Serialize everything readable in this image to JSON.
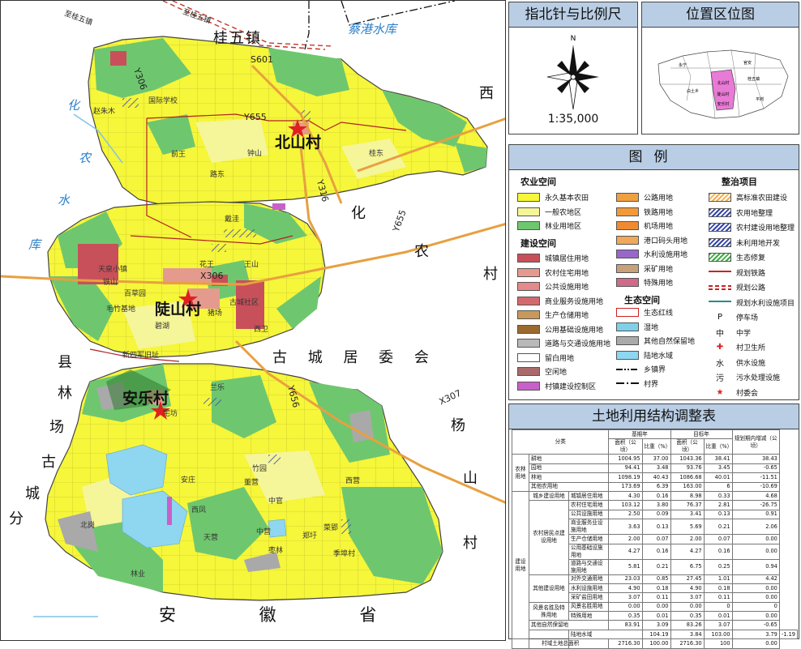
{
  "map": {
    "regions": {
      "guiwu": "桂五镇",
      "xi": "西",
      "hua": "化",
      "nong": "农",
      "cun": "村",
      "anhui": "安 徽 省",
      "gucheng_jwh": "古 城 居 委 会",
      "yang": "杨",
      "shan": "山",
      "cun2": "村",
      "west_col": [
        "县",
        "林",
        "场",
        "古",
        "城",
        "分"
      ]
    },
    "water": {
      "caigang": "蔡港水库",
      "west_col": [
        "化",
        "农",
        "水",
        "库"
      ]
    },
    "villages": {
      "beishan": "北山村",
      "lushan": "陡山村",
      "anle": "安乐村"
    },
    "roads": {
      "s601": "S601",
      "y316": "Y316",
      "y655": "Y655",
      "y655b": "Y655",
      "x306": "X306",
      "y656": "Y656",
      "x307": "X307",
      "y306": "Y306",
      "guiwu_road": "至桂五镇",
      "guiwu_road2": "至桂五镇"
    },
    "places": [
      "国际学校",
      "赵朱木",
      "钟山",
      "桂东",
      "前王",
      "路东",
      "戴洼",
      "花王",
      "王山",
      "天泉小镇",
      "毛竹基地",
      "碧湖",
      "铁山",
      "猪场",
      "古城社区",
      "西卫",
      "新四军旧址",
      "兰乐",
      "宅坊",
      "竹园",
      "中官",
      "董营",
      "安庄",
      "西营",
      "菜郢",
      "郑圩",
      "天营",
      "枣林",
      "北岗",
      "林业",
      "西凤",
      "季埠村",
      "中营",
      "百草园"
    ]
  },
  "compass": {
    "title": "指北针与比例尺",
    "north": "N",
    "scale": "1:35,000"
  },
  "location_panel": {
    "title": "位置区位图",
    "mini_labels": [
      "永宁",
      "官安",
      "北山村",
      "白土乡",
      "桂五镇",
      "陡山村",
      "安乐村",
      "平岗"
    ]
  },
  "legend": {
    "title": "图例",
    "groups": {
      "agri": "农业空间",
      "build": "建设空间",
      "eco": "生态空间",
      "renov": "整治项目"
    },
    "agri": [
      {
        "label": "永久基本农田",
        "color": "#f6f63a"
      },
      {
        "label": "一般农地区",
        "color": "#f5f59a"
      },
      {
        "label": "林业用地区",
        "color": "#6ec76e"
      }
    ],
    "build": [
      {
        "label": "城镇居住用地",
        "color": "#c8505a"
      },
      {
        "label": "农村住宅用地",
        "color": "#e59a8e"
      },
      {
        "label": "公共设施用地",
        "color": "#e48a8a"
      },
      {
        "label": "商业服务设施用地",
        "color": "#d4686f"
      },
      {
        "label": "生产仓储用地",
        "color": "#c7995a"
      },
      {
        "label": "公用基础设施用地",
        "color": "#9b6a2d"
      },
      {
        "label": "道路与交通设施用地",
        "color": "#b9b9b9"
      },
      {
        "label": "留白用地",
        "color": "#ffffff"
      },
      {
        "label": "空闲地",
        "color": "#a86a6a"
      },
      {
        "label": "村镇建设控制区",
        "color": "#c960c9"
      }
    ],
    "col2": [
      {
        "label": "公路用地",
        "color": "#f0a040"
      },
      {
        "label": "铁路用地",
        "color": "#f29a3a"
      },
      {
        "label": "机场用地",
        "color": "#f08a30"
      },
      {
        "label": "港口码头用地",
        "color": "#f0a85a"
      },
      {
        "label": "水利设施用地",
        "color": "#9966cc"
      },
      {
        "label": "采矿用地",
        "color": "#c8a07a"
      },
      {
        "label": "特殊用地",
        "color": "#d06a8a"
      }
    ],
    "eco": [
      {
        "label": "生态红线",
        "color": "#cc2222"
      },
      {
        "label": "湿地",
        "color": "#7fd0e8"
      },
      {
        "label": "其他自然保留地",
        "color": "#aaaaaa"
      },
      {
        "label": "陆地水域",
        "color": "#8fd6f0"
      },
      {
        "label": "乡镇界",
        "color": "#111111"
      },
      {
        "label": "村界",
        "color": "#111111"
      }
    ],
    "renov": [
      {
        "label": "高标准农田建设",
        "color": "#f0b050"
      },
      {
        "label": "农用地整理",
        "color": "#3344aa"
      },
      {
        "label": "农村建设用地整理",
        "color": "#3344aa"
      },
      {
        "label": "未利用地开发",
        "color": "#3344aa"
      },
      {
        "label": "生态修复",
        "color": "#44aa44"
      },
      {
        "label": "规划铁路",
        "color": "#cc2222"
      },
      {
        "label": "规划公路",
        "color": "#cc2222"
      },
      {
        "label": "规划水利设施项目",
        "color": "#2a8a8a"
      },
      {
        "label": "停车场",
        "icon": "P"
      },
      {
        "label": "中学",
        "icon": "中"
      },
      {
        "label": "村卫生所",
        "icon": "✚"
      },
      {
        "label": "供水设施",
        "icon": "水"
      },
      {
        "label": "污水处理设施",
        "icon": "污"
      },
      {
        "label": "村委会",
        "icon": "★"
      }
    ]
  },
  "table": {
    "title": "土地利用结构调整表",
    "headers": {
      "category": "分类",
      "base": "基期年",
      "target": "目标年",
      "change": "规划期内增减（公顷）",
      "area": "面积（公顷）",
      "ratio": "比重（%）"
    },
    "rows": [
      {
        "g1": "农林用地",
        "g2": "",
        "name": "耕地",
        "v": [
          "1004.95",
          "37.00",
          "1043.36",
          "38.41",
          "38.43"
        ]
      },
      {
        "g1": "",
        "g2": "",
        "name": "园地",
        "v": [
          "94.41",
          "3.48",
          "93.76",
          "3.45",
          "-0.65"
        ]
      },
      {
        "g1": "",
        "g2": "",
        "name": "林地",
        "v": [
          "1098.19",
          "40.43",
          "1086.68",
          "40.01",
          "-11.51"
        ]
      },
      {
        "g1": "",
        "g2": "",
        "name": "其他农用地",
        "v": [
          "173.69",
          "6.39",
          "163.00",
          "6",
          "-10.69"
        ]
      },
      {
        "g1": "建设用地",
        "g2": "城乡建设用地",
        "name": "城镇居住用地",
        "v": [
          "4.30",
          "0.16",
          "8.98",
          "0.33",
          "4.68"
        ]
      },
      {
        "g1": "",
        "g2": "农村居民点建设用地",
        "name": "农村住宅用地",
        "v": [
          "103.12",
          "3.80",
          "76.37",
          "2.81",
          "-26.75"
        ]
      },
      {
        "g1": "",
        "g2": "",
        "name": "公共设施用地",
        "v": [
          "2.50",
          "0.09",
          "3.41",
          "0.13",
          "0.91"
        ]
      },
      {
        "g1": "",
        "g2": "",
        "name": "商业服务业设施用地",
        "v": [
          "3.63",
          "0.13",
          "5.69",
          "0.21",
          "2.06"
        ]
      },
      {
        "g1": "",
        "g2": "",
        "name": "生产仓储用地",
        "v": [
          "2.00",
          "0.07",
          "2.00",
          "0.07",
          "0.00"
        ]
      },
      {
        "g1": "",
        "g2": "",
        "name": "公用基础设施用地",
        "v": [
          "4.27",
          "0.16",
          "4.27",
          "0.16",
          "0.00"
        ]
      },
      {
        "g1": "",
        "g2": "",
        "name": "道路与交通设施用地",
        "v": [
          "5.81",
          "0.21",
          "6.75",
          "0.25",
          "0.94"
        ]
      },
      {
        "g1": "",
        "g2": "其他建设用地",
        "name": "对外交通用地",
        "v": [
          "23.03",
          "0.85",
          "27.45",
          "1.01",
          "4.42"
        ]
      },
      {
        "g1": "",
        "g2": "",
        "name": "水利设施用地",
        "v": [
          "4.90",
          "0.18",
          "4.90",
          "0.18",
          "0.00"
        ]
      },
      {
        "g1": "",
        "g2": "",
        "name": "采矿盐田用地",
        "v": [
          "3.07",
          "0.11",
          "3.07",
          "0.11",
          "0.00"
        ]
      },
      {
        "g1": "",
        "g2": "风景名胜及特殊用地",
        "name": "风景名胜用地",
        "v": [
          "0.00",
          "0.00",
          "0.00",
          "0",
          "0"
        ]
      },
      {
        "g1": "",
        "g2": "",
        "name": "特殊用地",
        "v": [
          "0.35",
          "0.01",
          "0.35",
          "0.01",
          "0.00"
        ]
      },
      {
        "g1": "自然保护与保留用地",
        "g2": "",
        "name": "其他自然保留地",
        "v": [
          "83.91",
          "3.09",
          "83.26",
          "3.07",
          "-0.65"
        ]
      },
      {
        "g1": "",
        "g2": "",
        "name": "陆地水域",
        "v": [
          "104.19",
          "3.84",
          "103.00",
          "3.79",
          "-1.19"
        ]
      },
      {
        "g1": "",
        "g2": "",
        "name": "村域土地总面积",
        "v": [
          "2716.30",
          "100.00",
          "2716.30",
          "100",
          "0.00"
        ]
      }
    ]
  }
}
